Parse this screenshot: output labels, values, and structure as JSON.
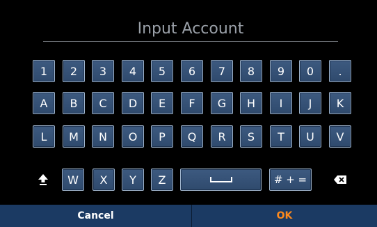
{
  "title": "Input Account",
  "rows": [
    [
      "1",
      "2",
      "3",
      "4",
      "5",
      "6",
      "7",
      "8",
      "9",
      "0",
      "."
    ],
    [
      "A",
      "B",
      "C",
      "D",
      "E",
      "F",
      "G",
      "H",
      "I",
      "J",
      "K"
    ],
    [
      "L",
      "M",
      "N",
      "O",
      "P",
      "Q",
      "R",
      "S",
      "T",
      "U",
      "V"
    ]
  ],
  "row4": {
    "shift_icon": "shift-arrow-icon",
    "letters": [
      "W",
      "X",
      "Y",
      "Z"
    ],
    "space_icon": "space-bar-icon",
    "symbols_label": "# + =",
    "backspace_icon": "backspace-icon"
  },
  "buttons": {
    "cancel_label": "Cancel",
    "ok_label": "OK"
  },
  "colors": {
    "key_fill": "#3d5a80",
    "key_border": "#9fb4cc",
    "bottom_bar": "#1b3a63",
    "ok_text": "#ff8a1c",
    "title_text": "#9aa0a8"
  }
}
